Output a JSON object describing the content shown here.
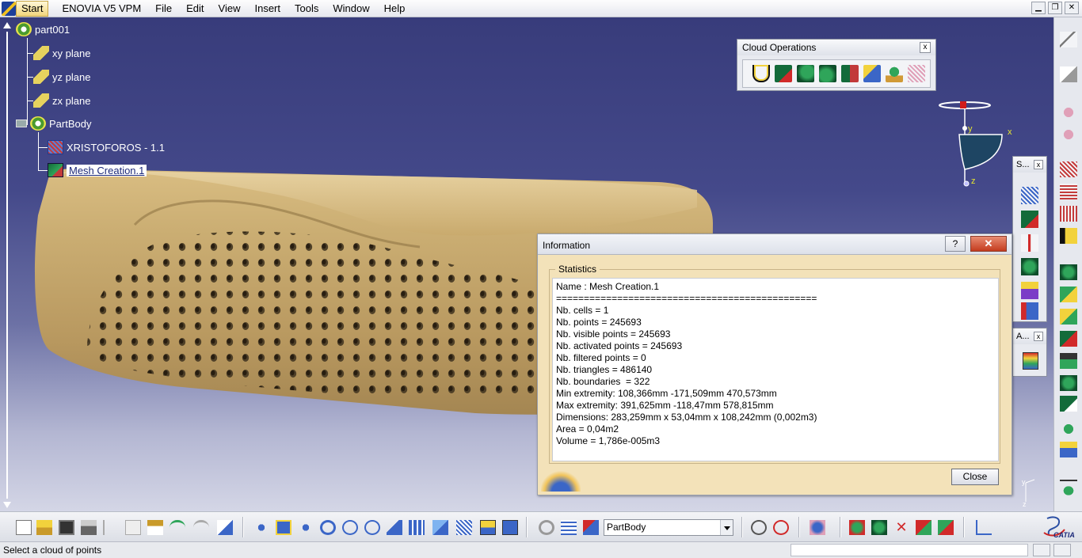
{
  "menubar": {
    "start": "Start",
    "items": [
      "ENOVIA V5 VPM",
      "File",
      "Edit",
      "View",
      "Insert",
      "Tools",
      "Window",
      "Help"
    ]
  },
  "tree": {
    "root": "part001",
    "planes": [
      "xy plane",
      "yz plane",
      "zx plane"
    ],
    "body": "PartBody",
    "cloud": "XRISTOFOROS - 1.1",
    "mesh": "Mesh Creation.1"
  },
  "cloud_ops": {
    "title": "Cloud Operations",
    "icons": [
      "union-icon",
      "remove-icon",
      "split-icon",
      "align-icon",
      "protect-icon",
      "activate-icon",
      "filter-icon",
      "sample-icon"
    ]
  },
  "mini_toolbar_s": {
    "title": "S..."
  },
  "mini_toolbar_a": {
    "title": "A..."
  },
  "compass_labels": {
    "x": "x",
    "y": "y",
    "z": "z"
  },
  "info_dialog": {
    "title": "Information",
    "help": "?",
    "group": "Statistics",
    "lines": [
      "Name : Mesh Creation.1",
      "===============================================",
      "Nb. cells = 1",
      "Nb. points = 245693",
      "Nb. visible points = 245693",
      "Nb. activated points = 245693",
      "Nb. filtered points = 0",
      "Nb. triangles = 486140",
      "Nb. boundaries  = 322",
      "Min extremity: 108,366mm -171,509mm 470,573mm",
      "Max extremity: 391,625mm -118,47mm 578,815mm",
      "Dimensions: 283,259mm x 53,04mm x 108,242mm (0,002m3)",
      "Area = 0,04m2",
      "Volume = 1,786e-005m3"
    ],
    "close": "Close"
  },
  "bottom_toolbar": {
    "body_select": "PartBody"
  },
  "catia_logo_text": "CATIA",
  "status": {
    "message": "Select a cloud of points"
  },
  "colors": {
    "viewport_top": "#383c7b",
    "viewport_bottom": "#d4d6e6",
    "part": "#c9a96a",
    "dialog_bg": "#f3e2b9"
  }
}
